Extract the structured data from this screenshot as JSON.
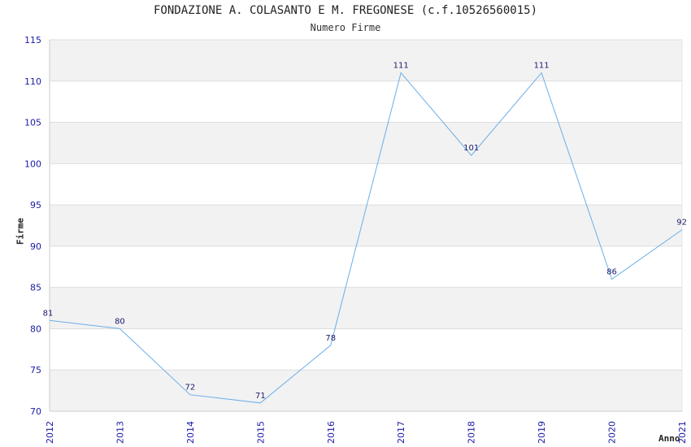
{
  "chart_data": {
    "type": "line",
    "title": "FONDAZIONE A. COLASANTO E M. FREGONESE (c.f.10526560015)",
    "subtitle": "Numero Firme",
    "xlabel": "Anno",
    "ylabel": "Firme",
    "categories": [
      "2012",
      "2013",
      "2014",
      "2015",
      "2016",
      "2017",
      "2018",
      "2019",
      "2020",
      "2021"
    ],
    "values": [
      81,
      80,
      72,
      71,
      78,
      111,
      101,
      111,
      86,
      92
    ],
    "ylim": [
      70,
      115
    ],
    "yticks": [
      "70",
      "75",
      "80",
      "85",
      "90",
      "95",
      "100",
      "105",
      "110",
      "115"
    ],
    "grid": true,
    "line_color": "#6aaee8",
    "band_color": "#f2f2f2",
    "tick_color": "#1a1aa6"
  }
}
